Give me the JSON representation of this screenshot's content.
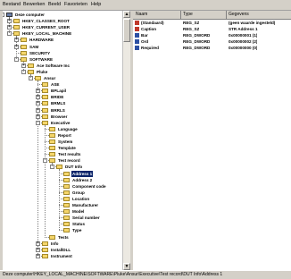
{
  "menu": [
    "Bestand",
    "Bewerken",
    "Beeld",
    "Favorieten",
    "Help"
  ],
  "tree": [
    {
      "label": "Deze computer",
      "depth": 0,
      "expander": "-",
      "icon": "computer-icon"
    },
    {
      "label": "HKEY_CLASSES_ROOT",
      "depth": 1,
      "expander": "+",
      "icon": "folder-icon"
    },
    {
      "label": "HKEY_CURRENT_USER",
      "depth": 1,
      "expander": "+",
      "icon": "folder-icon"
    },
    {
      "label": "HKEY_LOCAL_MACHINE",
      "depth": 1,
      "expander": "-",
      "icon": "folder-open-icon"
    },
    {
      "label": "HARDWARE",
      "depth": 2,
      "expander": "+",
      "icon": "folder-icon"
    },
    {
      "label": "SAM",
      "depth": 2,
      "expander": "+",
      "icon": "folder-icon"
    },
    {
      "label": "SECURITY",
      "depth": 2,
      "expander": "",
      "icon": "folder-icon"
    },
    {
      "label": "SOFTWARE",
      "depth": 2,
      "expander": "-",
      "icon": "folder-open-icon"
    },
    {
      "label": "Ace Software Inc",
      "depth": 3,
      "expander": "+",
      "icon": "folder-icon"
    },
    {
      "label": "Pluke",
      "depth": 3,
      "expander": "-",
      "icon": "folder-open-icon"
    },
    {
      "label": "Ansur",
      "depth": 4,
      "expander": "-",
      "icon": "folder-open-icon"
    },
    {
      "label": "ASE",
      "depth": 5,
      "expander": "",
      "icon": "folder-icon"
    },
    {
      "label": "BPLapil",
      "depth": 5,
      "expander": "+",
      "icon": "folder-icon"
    },
    {
      "label": "BRIDE",
      "depth": 5,
      "expander": "+",
      "icon": "folder-icon"
    },
    {
      "label": "BRMLS",
      "depth": 5,
      "expander": "+",
      "icon": "folder-icon"
    },
    {
      "label": "BRRLS",
      "depth": 5,
      "expander": "+",
      "icon": "folder-icon"
    },
    {
      "label": "Browser",
      "depth": 5,
      "expander": "+",
      "icon": "folder-icon"
    },
    {
      "label": "Executive",
      "depth": 5,
      "expander": "-",
      "icon": "folder-open-icon"
    },
    {
      "label": "Language",
      "depth": 6,
      "expander": "",
      "icon": "folder-icon"
    },
    {
      "label": "Report",
      "depth": 6,
      "expander": "",
      "icon": "folder-icon"
    },
    {
      "label": "System",
      "depth": 6,
      "expander": "",
      "icon": "folder-icon"
    },
    {
      "label": "Template",
      "depth": 6,
      "expander": "",
      "icon": "folder-icon"
    },
    {
      "label": "Test results",
      "depth": 6,
      "expander": "",
      "icon": "folder-icon"
    },
    {
      "label": "Test record",
      "depth": 6,
      "expander": "-",
      "icon": "folder-open-icon"
    },
    {
      "label": "DUT Info",
      "depth": 7,
      "expander": "-",
      "icon": "folder-open-icon"
    },
    {
      "label": "Address 1",
      "depth": 8,
      "expander": "",
      "icon": "folder-open-icon",
      "selected": true
    },
    {
      "label": "Address 2",
      "depth": 8,
      "expander": "",
      "icon": "folder-icon"
    },
    {
      "label": "Component code",
      "depth": 8,
      "expander": "",
      "icon": "folder-icon"
    },
    {
      "label": "Group",
      "depth": 8,
      "expander": "",
      "icon": "folder-icon"
    },
    {
      "label": "Location",
      "depth": 8,
      "expander": "",
      "icon": "folder-icon"
    },
    {
      "label": "Manufacturer",
      "depth": 8,
      "expander": "",
      "icon": "folder-icon"
    },
    {
      "label": "Model",
      "depth": 8,
      "expander": "",
      "icon": "folder-icon"
    },
    {
      "label": "Serial number",
      "depth": 8,
      "expander": "",
      "icon": "folder-icon"
    },
    {
      "label": "Status",
      "depth": 8,
      "expander": "",
      "icon": "folder-icon"
    },
    {
      "label": "Type",
      "depth": 8,
      "expander": "",
      "icon": "folder-icon"
    },
    {
      "label": "Tests",
      "depth": 6,
      "expander": "",
      "icon": "folder-icon"
    },
    {
      "label": "Info",
      "depth": 5,
      "expander": "+",
      "icon": "folder-icon"
    },
    {
      "label": "InstallDLL",
      "depth": 5,
      "expander": "+",
      "icon": "folder-icon"
    },
    {
      "label": "Instrument",
      "depth": 5,
      "expander": "+",
      "icon": "folder-icon"
    }
  ],
  "list": {
    "columns": [
      "Naam",
      "Type",
      "Gegevens"
    ],
    "rows": [
      {
        "name": "(Standaard)",
        "type": "REG_SZ",
        "data": "(geen waarde ingesteld)",
        "icon": "string-value-icon"
      },
      {
        "name": "Caption",
        "type": "REG_SZ",
        "data": "STR Address 1",
        "icon": "string-value-icon"
      },
      {
        "name": "Bar",
        "type": "REG_DWORD",
        "data": "0x00000001 (1)",
        "icon": "dword-value-icon"
      },
      {
        "name": "Ord",
        "type": "REG_DWORD",
        "data": "0x00000002 (2)",
        "icon": "dword-value-icon"
      },
      {
        "name": "Required",
        "type": "REG_DWORD",
        "data": "0x00000000 (0)",
        "icon": "dword-value-icon"
      }
    ]
  },
  "status": "Deze computer\\HKEY_LOCAL_MACHINE\\SOFTWARE\\Pluke\\Ansur\\Executive\\Test record\\DUT Info\\Address 1",
  "colors": {
    "selection": "#0a246a",
    "folder": "#f5d66b",
    "window": "#d4d0c8"
  }
}
